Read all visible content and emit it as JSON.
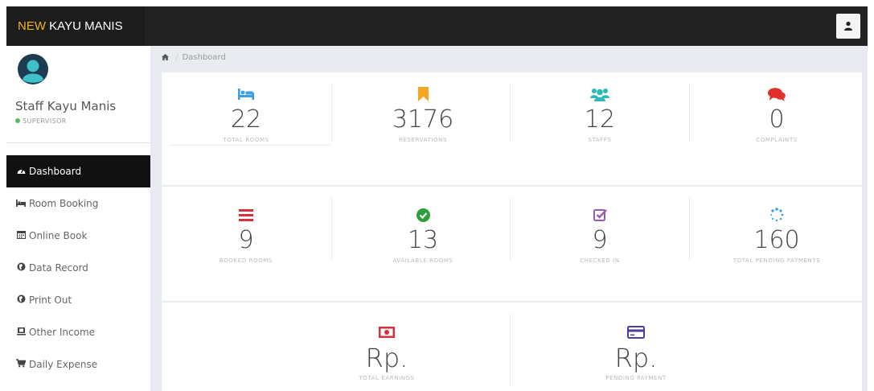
{
  "navbar": {
    "brand_part1": "NEW",
    "brand_part2": "KAYU MANIS"
  },
  "sidebar": {
    "user_name": "Staff Kayu Manis",
    "user_role": "SUPERVISOR",
    "menu": [
      {
        "label": "Dashboard",
        "icon": "dashboard-icon",
        "active": true
      },
      {
        "label": "Room Booking",
        "icon": "bed-icon"
      },
      {
        "label": "Online Book",
        "icon": "calendar-icon"
      },
      {
        "label": "Data Record",
        "icon": "globe-icon"
      },
      {
        "label": "Print Out",
        "icon": "globe-icon"
      },
      {
        "label": "Other Income",
        "icon": "money-icon"
      },
      {
        "label": "Daily Expense",
        "icon": "cart-icon"
      }
    ]
  },
  "breadcrumb": {
    "home_icon": "home-icon",
    "current": "Dashboard"
  },
  "stats_row1": [
    {
      "value": "22",
      "label": "TOTAL ROOMS",
      "icon": "bed-icon",
      "color": "#3c9ee5"
    },
    {
      "value": "3176",
      "label": "RESERVATIONS",
      "icon": "bookmark-icon",
      "color": "#f5a623"
    },
    {
      "value": "12",
      "label": "STAFFS",
      "icon": "users-icon",
      "color": "#2bb9b9"
    },
    {
      "value": "0",
      "label": "COMPLAINTS",
      "icon": "comments-icon",
      "color": "#e0302a"
    }
  ],
  "stats_row2": [
    {
      "value": "9",
      "label": "BOOKED ROOMS",
      "icon": "list-icon",
      "color": "#d9303b"
    },
    {
      "value": "13",
      "label": "AVAILABLE ROOMS",
      "icon": "check-circle-icon",
      "color": "#2e9e3c"
    },
    {
      "value": "9",
      "label": "CHECKED IN",
      "icon": "check-square-icon",
      "color": "#9b59b6"
    },
    {
      "value": "160",
      "label": "TOTAL PENDING PAYMENTS",
      "icon": "spinner-icon",
      "color": "#3c9ee5"
    }
  ],
  "stats_row3": [
    {
      "value": "Rp.",
      "label": "TOTAL EARNINGS",
      "icon": "money-bill-icon",
      "color": "#d9303b"
    },
    {
      "value": "Rp.",
      "label": "PENDING PAYMENT",
      "icon": "credit-card-icon",
      "color": "#4a3f9b"
    }
  ]
}
